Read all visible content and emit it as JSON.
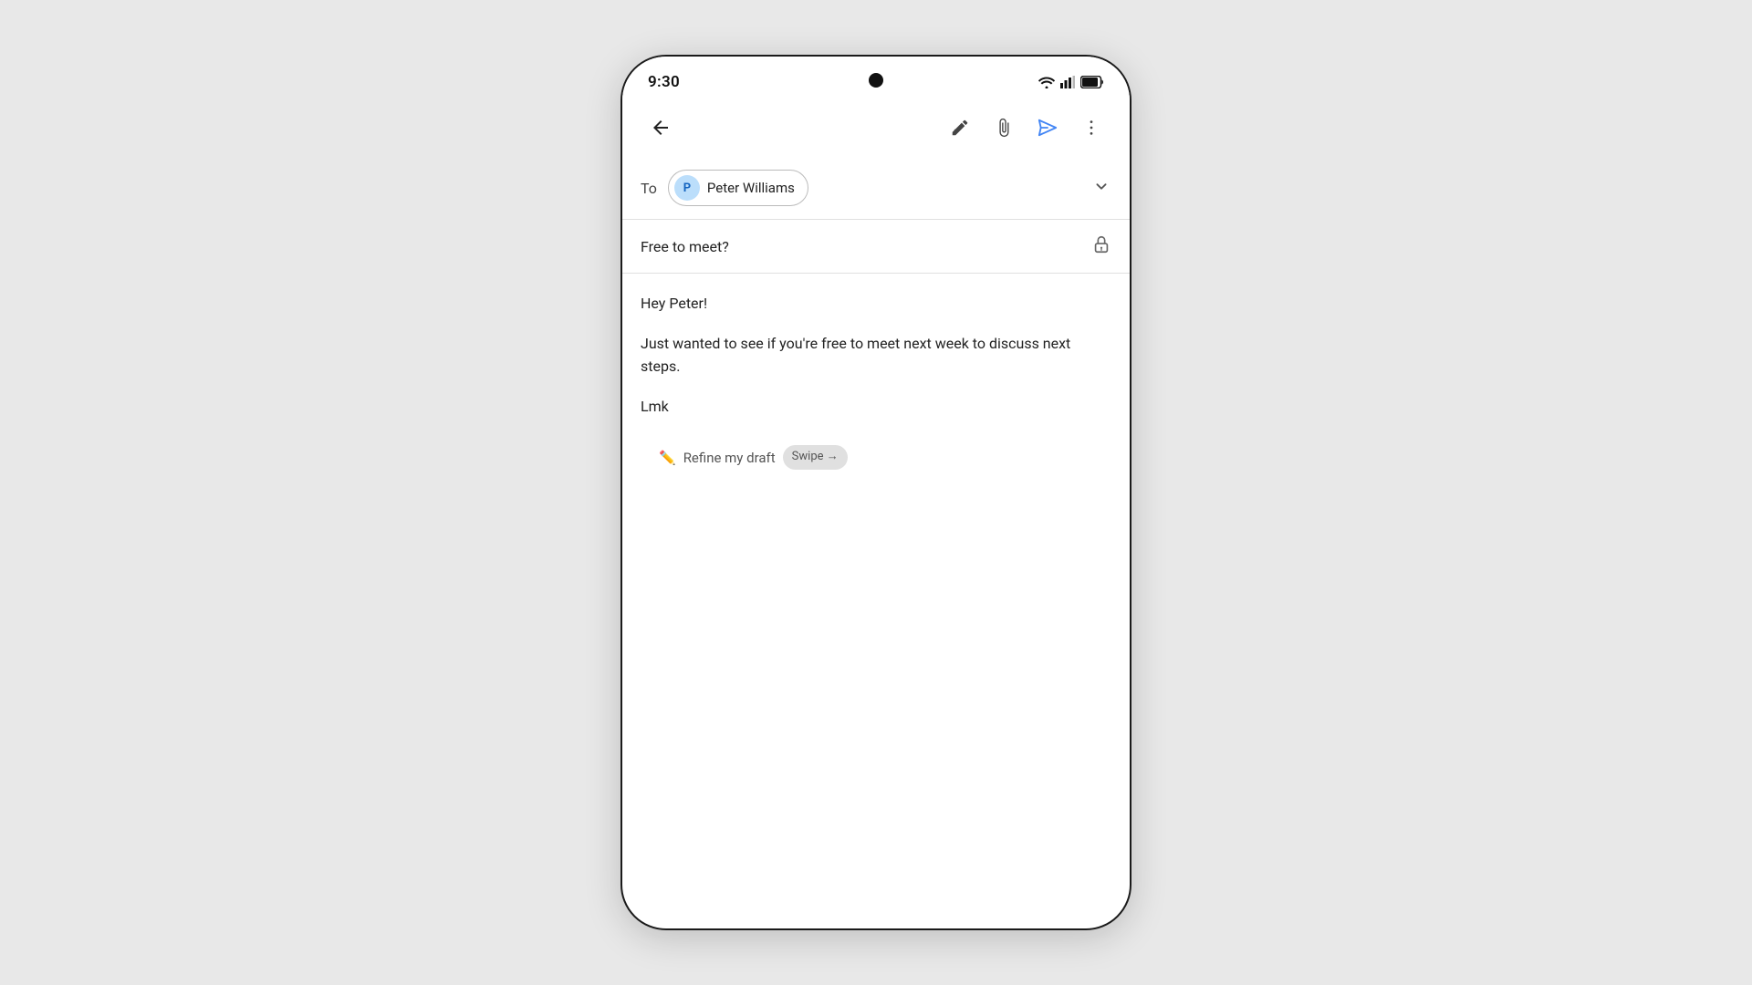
{
  "status_bar": {
    "time": "9:30"
  },
  "toolbar": {
    "back_label": "back",
    "edit_label": "edit",
    "attach_label": "attach",
    "send_label": "send",
    "more_label": "more options"
  },
  "compose": {
    "to_label": "To",
    "recipient": {
      "initial": "P",
      "name": "Peter Williams"
    },
    "subject": "Free to meet?",
    "body_line1": "Hey Peter!",
    "body_line2": "Just wanted to see if you're free to meet next week to discuss next steps.",
    "body_line3": "Lmk"
  },
  "refine": {
    "text": "Refine my draft",
    "swipe_label": "Swipe →"
  }
}
